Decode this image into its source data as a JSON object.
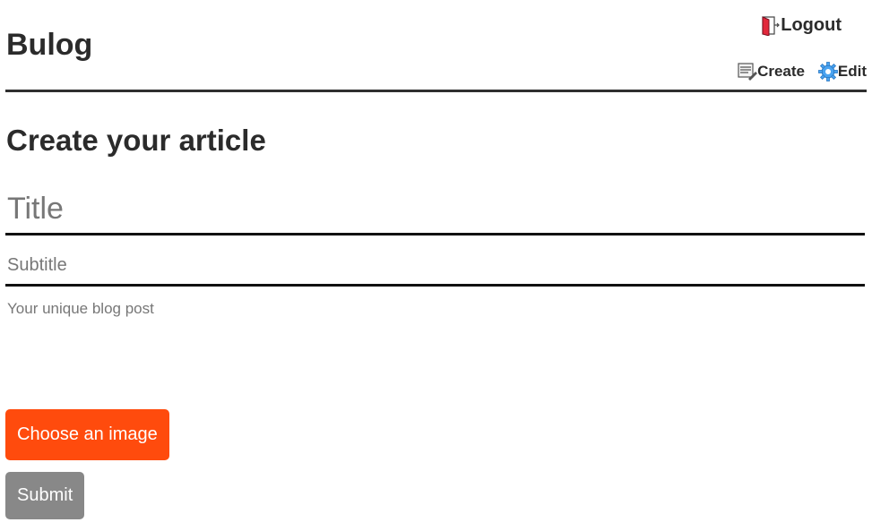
{
  "header": {
    "brand": "Bulog",
    "nav": {
      "logout_label": "Logout",
      "logout_icon": "door-exit-icon",
      "create_label": "Create",
      "create_icon": "document-pencil-icon",
      "edit_label": "Edit",
      "edit_icon": "gear-icon"
    }
  },
  "main": {
    "title": "Create your article",
    "form": {
      "title_placeholder": "Title",
      "title_value": "",
      "subtitle_placeholder": "Subtitle",
      "subtitle_value": "",
      "body_placeholder": "Your unique blog post",
      "body_value": "",
      "choose_image_label": "Choose an image",
      "submit_label": "Submit"
    }
  },
  "colors": {
    "accent": "#ff4b0d",
    "submit_disabled": "#888888",
    "text": "#2b2b2b",
    "rule": "#111111"
  }
}
